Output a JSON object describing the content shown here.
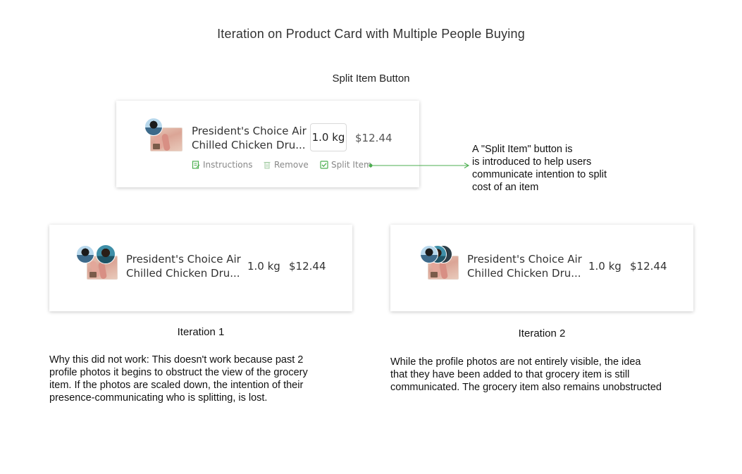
{
  "page_title": "Iteration on Product Card with Multiple People Buying",
  "section_title": "Split Item Button",
  "top_card": {
    "product_name_line1": "President's Choice Air",
    "product_name_line2": "Chilled Chicken Dru...",
    "quantity": "1.0 kg",
    "price": "$12.44",
    "actions": {
      "instructions": "Instructions",
      "remove": "Remove",
      "split_item": "Split Item"
    }
  },
  "annotation": {
    "line1": "A \"Split Item\" button is",
    "line2": "is introduced to help users",
    "line3": "communicate intention to split",
    "line4": "cost of an item"
  },
  "iteration1": {
    "product_name_line1": "President's Choice Air",
    "product_name_line2": "Chilled Chicken Dru...",
    "quantity": "1.0 kg",
    "price": "$12.44",
    "caption": "Iteration 1",
    "desc_line1": "Why this did not work: This doesn't work because past 2",
    "desc_line2": "profile photos it begins to obstruct the view of the grocery",
    "desc_line3": "item. If the photos are scaled down, the intention of their",
    "desc_line4": "presence-communicating who is splitting, is lost."
  },
  "iteration2": {
    "product_name_line1": "President's Choice Air",
    "product_name_line2": "Chilled Chicken Dru...",
    "quantity": "1.0 kg",
    "price": "$12.44",
    "caption": "Iteration 2",
    "desc_line1": "While the profile photos are not entirely visible, the idea",
    "desc_line2": "that they have been added to that grocery item is still",
    "desc_line3": "communicated. The grocery item also remains unobstructed"
  },
  "colors": {
    "accent_green": "#4caf50",
    "text_dark": "#222222",
    "icon_grey": "#9e9e9e"
  }
}
